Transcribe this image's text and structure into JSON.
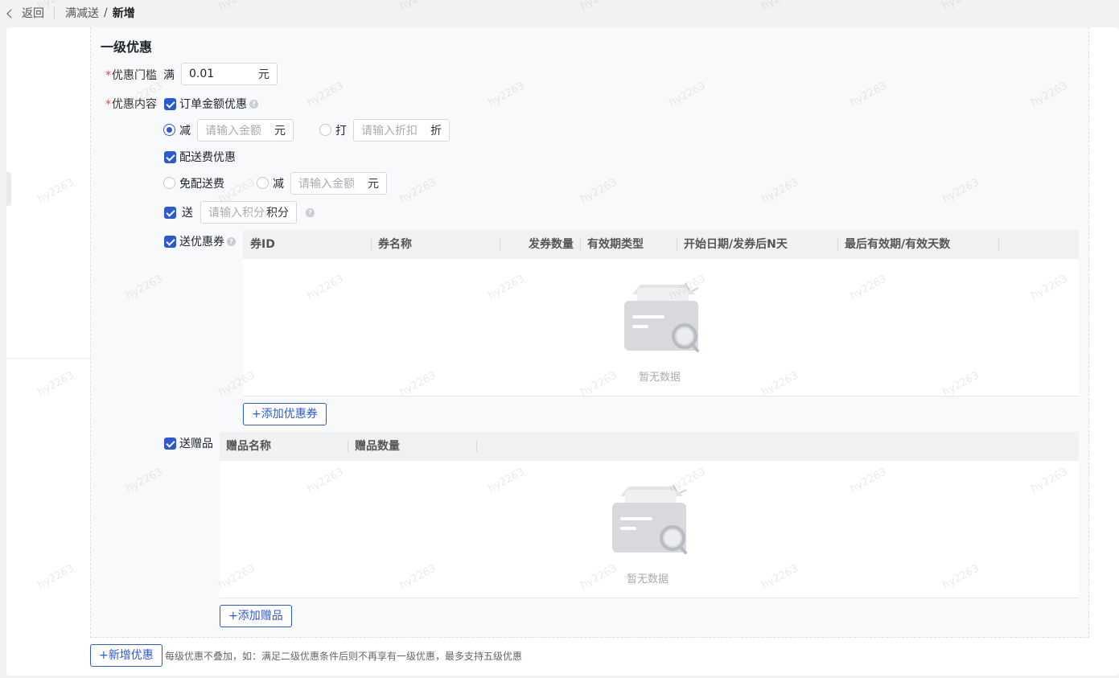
{
  "header": {
    "back_label": "返回",
    "breadcrumb_parent": "满减送",
    "breadcrumb_separator": "/",
    "breadcrumb_current": "新增"
  },
  "level": {
    "title": "一级优惠",
    "threshold": {
      "required_mark": "*",
      "label": "优惠门槛",
      "prefix": "满",
      "value": "0.01",
      "unit": "元"
    },
    "content": {
      "required_mark": "*",
      "label": "优惠内容",
      "order_amount": {
        "checked": true,
        "label": "订单金额优惠",
        "reduce_label": "减",
        "reduce_selected": true,
        "reduce_placeholder": "请输入金额",
        "reduce_unit": "元",
        "discount_label": "打",
        "discount_placeholder": "请输入折扣",
        "discount_unit": "折"
      },
      "delivery": {
        "checked": true,
        "label": "配送费优惠",
        "free_label": "免配送费",
        "reduce_label": "减",
        "reduce_placeholder": "请输入金额",
        "reduce_unit": "元"
      },
      "points": {
        "checked": true,
        "label": "送",
        "placeholder": "请输入积分",
        "unit": "积分"
      },
      "coupons": {
        "checked": true,
        "label": "送优惠券",
        "columns": [
          "券ID",
          "券名称",
          "发券数量",
          "有效期类型",
          "开始日期/发券后N天",
          "最后有效期/有效天数"
        ],
        "empty_text": "暂无数据",
        "add_button": "+添加优惠券"
      },
      "gifts": {
        "checked": true,
        "label": "送赠品",
        "columns": [
          "赠品名称",
          "赠品数量"
        ],
        "empty_text": "暂无数据",
        "add_button": "+添加赠品"
      }
    }
  },
  "footer": {
    "add_level_button": "+新增优惠",
    "hint": "每级优惠不叠加，如：满足二级优惠条件后则不再享有一级优惠，最多支持五级优惠"
  },
  "watermark": "hy2263",
  "colors": {
    "primary": "#2c58d6",
    "required": "#e5484d",
    "placeholder": "#a8abb2"
  }
}
